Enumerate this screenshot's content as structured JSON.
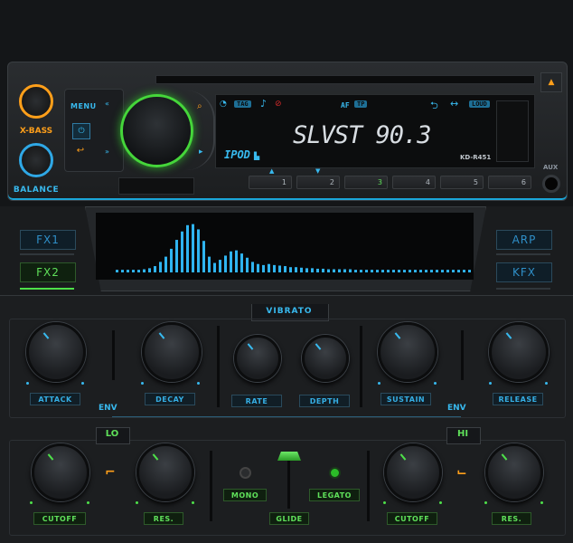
{
  "head_unit": {
    "xbass_label": "X-BASS",
    "balance_label": "BALANCE",
    "menu_label": "MENU",
    "station_text": "SLVST 90.3",
    "source_label": "IPOD",
    "model_label": "KD-R451",
    "tag_label": "TAG",
    "af_label": "AF",
    "tp_label": "TP",
    "loud_label": "LOUD",
    "aux_label": "AUX",
    "eject_icon": "▲",
    "presets": [
      "1",
      "2",
      "3",
      "4",
      "5",
      "6"
    ],
    "active_preset": "3"
  },
  "fx": {
    "left": [
      "FX1",
      "FX2"
    ],
    "right": [
      "ARP",
      "KFX"
    ],
    "active": "FX2",
    "spectrum_levels": [
      0.05,
      0.05,
      0.05,
      0.05,
      0.05,
      0.06,
      0.08,
      0.12,
      0.2,
      0.3,
      0.45,
      0.62,
      0.78,
      0.9,
      0.92,
      0.82,
      0.6,
      0.3,
      0.18,
      0.24,
      0.32,
      0.4,
      0.42,
      0.36,
      0.28,
      0.2,
      0.16,
      0.14,
      0.16,
      0.14,
      0.13,
      0.12,
      0.1,
      0.1,
      0.09,
      0.08,
      0.08,
      0.07,
      0.07,
      0.06,
      0.06,
      0.06,
      0.06,
      0.06,
      0.05,
      0.05,
      0.05,
      0.05,
      0.05,
      0.05,
      0.05,
      0.05,
      0.05,
      0.05,
      0.05,
      0.05,
      0.05,
      0.05,
      0.05,
      0.05,
      0.05,
      0.05,
      0.05,
      0.05,
      0.05,
      0.05
    ]
  },
  "vibrato": {
    "title": "VIBRATO",
    "knobs": [
      "ATTACK",
      "DECAY",
      "RATE",
      "DEPTH",
      "SUSTAIN",
      "RELEASE"
    ],
    "env_left": "ENV",
    "env_right": "ENV"
  },
  "filter": {
    "lo_label": "LO",
    "hi_label": "HI",
    "left_knobs": [
      "CUTOFF",
      "RES."
    ],
    "right_knobs": [
      "CUTOFF",
      "RES."
    ],
    "mono_label": "MONO",
    "legato_label": "LEGATO",
    "glide_label": "GLIDE"
  },
  "colors": {
    "accent_blue": "#38b9ee",
    "accent_green": "#4ee04a",
    "accent_orange": "#ff9f1a",
    "lcd_text": "#d8dde2"
  }
}
